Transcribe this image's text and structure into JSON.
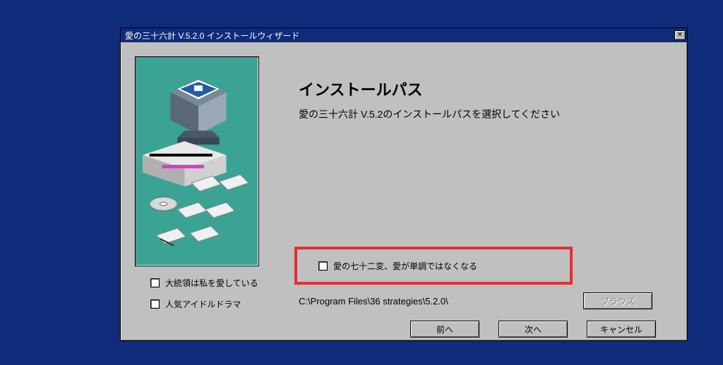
{
  "titlebar": {
    "text": "愛の三十六計 V.5.2.0 インストールウィザード",
    "close_glyph": "✕"
  },
  "heading": "インストールパス",
  "subheading": "愛の三十六計 V.5.2のインストールパスを選択してください",
  "options": {
    "president": "大統領は私を愛している",
    "drama": "人気アイドルドラマ",
    "seventy_two": "愛の七十二変、愛が単調ではなくなる"
  },
  "install_path": "C:\\Program Files\\36 strategies\\5.2.0\\",
  "buttons": {
    "browse": "ブラウズ",
    "back": "前へ",
    "next": "次へ",
    "cancel": "キャンセル"
  },
  "colors": {
    "desktop_bg": "#0f2b7a",
    "window_face": "#c0c0c0",
    "sidebar_teal": "#3aa394",
    "highlight_red": "#e03131"
  }
}
